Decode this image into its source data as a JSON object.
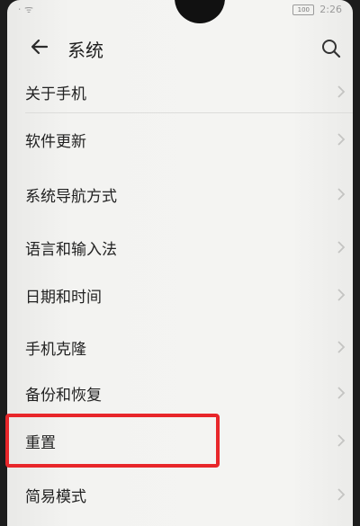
{
  "status_bar": {
    "left_icons": "⋅ ᯤ",
    "battery": "100",
    "time": "2:26"
  },
  "header": {
    "title": "系统"
  },
  "menu": {
    "items": [
      {
        "label": "关于手机"
      },
      {
        "label": "软件更新"
      },
      {
        "label": "系统导航方式"
      },
      {
        "label": "语言和输入法"
      },
      {
        "label": "日期和时间"
      },
      {
        "label": "手机克隆"
      },
      {
        "label": "备份和恢复"
      },
      {
        "label": "重置"
      },
      {
        "label": "简易模式"
      }
    ]
  },
  "highlight_color": "#e8262a",
  "icons": {
    "back": "back-arrow-icon",
    "search": "search-icon",
    "chevron": "chevron-right-icon"
  }
}
